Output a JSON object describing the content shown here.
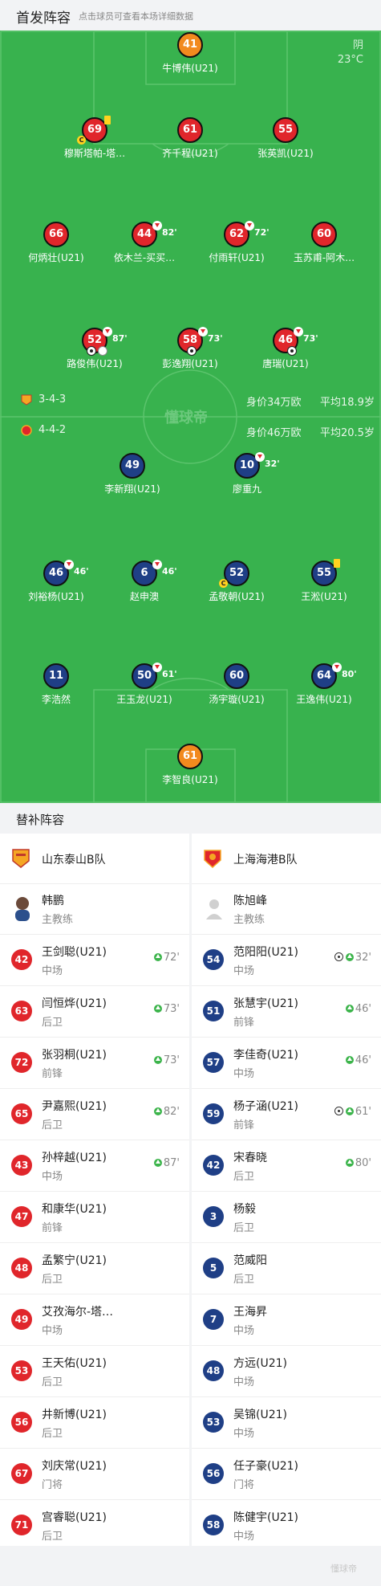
{
  "header": {
    "title": "首发阵容",
    "subtitle": "点击球员可查看本场详细数据"
  },
  "weather": {
    "condition": "阴",
    "temp": "23°C"
  },
  "watermark": "懂球帝",
  "home_team": {
    "formation": "3-4-3",
    "value": "身价34万欧",
    "age": "平均18.9岁",
    "color": "#e0262b"
  },
  "away_team": {
    "formation": "4-4-2",
    "value": "身价46万欧",
    "age": "平均20.5岁",
    "color": "#1f3f86"
  },
  "home_players": [
    {
      "num": "41",
      "name": "牛博伟(U21)"
    },
    {
      "num": "69",
      "name": "穆斯塔帕-塔…"
    },
    {
      "num": "61",
      "name": "齐千程(U21)"
    },
    {
      "num": "55",
      "name": "张英凯(U21)"
    },
    {
      "num": "66",
      "name": "何炳壮(U21)"
    },
    {
      "num": "44",
      "name": "依木兰-买买…",
      "sub": "82'"
    },
    {
      "num": "62",
      "name": "付雨轩(U21)",
      "sub": "72'"
    },
    {
      "num": "60",
      "name": "玉苏甫-阿木…"
    },
    {
      "num": "52",
      "name": "路俊伟(U21)",
      "sub": "87'"
    },
    {
      "num": "58",
      "name": "彭逸翔(U21)",
      "sub": "73'"
    },
    {
      "num": "46",
      "name": "唐瑞(U21)",
      "sub": "73'"
    }
  ],
  "away_players": [
    {
      "num": "49",
      "name": "李新翔(U21)"
    },
    {
      "num": "10",
      "name": "廖重九",
      "sub": "32'"
    },
    {
      "num": "46",
      "name": "刘裕杨(U21)",
      "sub": "46'"
    },
    {
      "num": "6",
      "name": "赵申澳",
      "sub": "46'"
    },
    {
      "num": "52",
      "name": "孟敬朝(U21)"
    },
    {
      "num": "55",
      "name": "王淞(U21)"
    },
    {
      "num": "11",
      "name": "李浩然"
    },
    {
      "num": "50",
      "name": "王玉龙(U21)",
      "sub": "61'"
    },
    {
      "num": "60",
      "name": "汤宇璇(U21)"
    },
    {
      "num": "64",
      "name": "王逸伟(U21)",
      "sub": "80'"
    },
    {
      "num": "61",
      "name": "李智良(U21)"
    }
  ],
  "subs": {
    "title": "替补阵容",
    "left": {
      "team": "山东泰山B队",
      "coach": {
        "name": "韩鹏",
        "role": "主教练"
      },
      "players": [
        {
          "num": "42",
          "name": "王剑聪(U21)",
          "pos": "中场",
          "ev": "72'"
        },
        {
          "num": "63",
          "name": "闫恒烨(U21)",
          "pos": "后卫",
          "ev": "73'"
        },
        {
          "num": "72",
          "name": "张羽桐(U21)",
          "pos": "前锋",
          "ev": "73'"
        },
        {
          "num": "65",
          "name": "尹嘉熙(U21)",
          "pos": "后卫",
          "ev": "82'"
        },
        {
          "num": "43",
          "name": "孙梓越(U21)",
          "pos": "中场",
          "ev": "87'"
        },
        {
          "num": "47",
          "name": "和康华(U21)",
          "pos": "前锋",
          "ev": ""
        },
        {
          "num": "48",
          "name": "孟繁宁(U21)",
          "pos": "后卫",
          "ev": ""
        },
        {
          "num": "49",
          "name": "艾孜海尔-塔…",
          "pos": "中场",
          "ev": ""
        },
        {
          "num": "53",
          "name": "王天佑(U21)",
          "pos": "后卫",
          "ev": ""
        },
        {
          "num": "56",
          "name": "井新博(U21)",
          "pos": "后卫",
          "ev": ""
        },
        {
          "num": "67",
          "name": "刘庆常(U21)",
          "pos": "门将",
          "ev": ""
        },
        {
          "num": "71",
          "name": "宫睿聪(U21)",
          "pos": "后卫",
          "ev": ""
        }
      ]
    },
    "right": {
      "team": "上海海港B队",
      "coach": {
        "name": "陈旭峰",
        "role": "主教练"
      },
      "players": [
        {
          "num": "54",
          "name": "范阳阳(U21)",
          "pos": "中场",
          "ev": "32'",
          "goal": true
        },
        {
          "num": "51",
          "name": "张慧宇(U21)",
          "pos": "前锋",
          "ev": "46'"
        },
        {
          "num": "57",
          "name": "李佳奇(U21)",
          "pos": "中场",
          "ev": "46'"
        },
        {
          "num": "59",
          "name": "杨子涵(U21)",
          "pos": "前锋",
          "ev": "61'",
          "goal": true
        },
        {
          "num": "42",
          "name": "宋春晓",
          "pos": "后卫",
          "ev": "80'"
        },
        {
          "num": "3",
          "name": "杨毅",
          "pos": "后卫",
          "ev": ""
        },
        {
          "num": "5",
          "name": "范威阳",
          "pos": "后卫",
          "ev": ""
        },
        {
          "num": "7",
          "name": "王海昇",
          "pos": "中场",
          "ev": ""
        },
        {
          "num": "48",
          "name": "方远(U21)",
          "pos": "中场",
          "ev": ""
        },
        {
          "num": "53",
          "name": "吴锦(U21)",
          "pos": "中场",
          "ev": ""
        },
        {
          "num": "56",
          "name": "任子豪(U21)",
          "pos": "门将",
          "ev": ""
        },
        {
          "num": "58",
          "name": "陈健宇(U21)",
          "pos": "中场",
          "ev": ""
        }
      ]
    }
  },
  "footer": {
    "watermark": "懂球帝"
  }
}
